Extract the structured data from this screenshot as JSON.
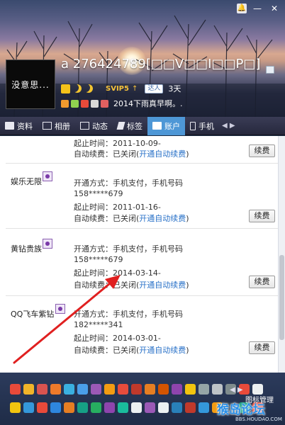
{
  "window": {
    "controls": [
      "🔔",
      "—",
      "✕"
    ]
  },
  "profile": {
    "avatar_text": "没意思...",
    "nickname": "a 276424789[□□V□□I□□P□]",
    "svip_label": "SVIP5",
    "svip_arrow": "↑",
    "friend_badge": "达人",
    "days": "3天",
    "signature": "2014下雨真早啊。."
  },
  "tabs": [
    {
      "label": "资料",
      "icon": "profile-card-icon",
      "active": false
    },
    {
      "label": "相册",
      "icon": "photo-album-icon",
      "active": false
    },
    {
      "label": "动态",
      "icon": "feed-icon",
      "active": false
    },
    {
      "label": "标签",
      "icon": "tag-icon",
      "active": false
    },
    {
      "label": "账户",
      "icon": "account-icon",
      "active": true
    },
    {
      "label": "手机",
      "icon": "mobile-phone-icon",
      "active": false
    }
  ],
  "tab_arrows": "◀ ▶",
  "services": [
    {
      "name": "",
      "start_date": "起止时间：2011-10-09-",
      "auto_renew_prefix": "自动续费：已关闭(",
      "auto_renew_link": "开通自动续费",
      "auto_renew_suffix": ")",
      "renew_button": "续费"
    },
    {
      "name": "娱乐无限",
      "method": "开通方式：手机支付，手机号码",
      "phone": "158*****679",
      "start_date": "起止时间：2011-01-16-",
      "auto_renew_prefix": "自动续费：已关闭(",
      "auto_renew_link": "开通自动续费",
      "auto_renew_suffix": ")",
      "renew_button": "续费"
    },
    {
      "name": "黄钻贵族",
      "method": "开通方式：手机支付，手机号码",
      "phone": "158*****679",
      "start_date": "起止时间：2014-03-14-",
      "auto_renew_prefix": "自动续费：已关闭(",
      "auto_renew_link": "开通自动续费",
      "auto_renew_suffix": ")",
      "renew_button": "续费"
    },
    {
      "name": "QQ飞车紫钻",
      "method": "开通方式：手机支付，手机号码",
      "phone": "182*****341",
      "start_date": "起止时间：2014-03-01-",
      "auto_renew_prefix": "自动续费：已关闭(",
      "auto_renew_link": "开通自动续费",
      "auto_renew_suffix": ")",
      "renew_button": "续费"
    }
  ],
  "appbar": {
    "arrows": "◀ ▶",
    "manage_label": "图标管理",
    "watermark": "猴岛论坛",
    "watermark_url": "BBS.HOUDAO.COM",
    "row1_colors": [
      "#e84a3a",
      "#f0b429",
      "#d9534f",
      "#ee7a2a",
      "#3ab0e0",
      "#4a9fe8",
      "#9b59b6",
      "#f39c12",
      "#e74c3c",
      "#c0392b",
      "#e67e22",
      "#d35400",
      "#8e44ad",
      "#f1c40f",
      "#95a5a6",
      "#bdc3c7",
      "#7f8c8d",
      "#e84a3a",
      "#ecf0f1"
    ],
    "row2_colors": [
      "#f1c40f",
      "#3498db",
      "#e84a3a",
      "#2e86de",
      "#e67e22",
      "#16a085",
      "#27ae60",
      "#8e44ad",
      "#1abc9c",
      "#ecf0f1",
      "#9b59b6",
      "#ecf0f1",
      "#2980b9",
      "#c0392b",
      "#3498db",
      "#f39c12",
      "#2c3e50",
      "#16a085",
      "#e74c3c"
    ]
  },
  "colors": {
    "tab_active": "#4e97d6",
    "link": "#2a72c8",
    "arrow": "#e02020"
  }
}
